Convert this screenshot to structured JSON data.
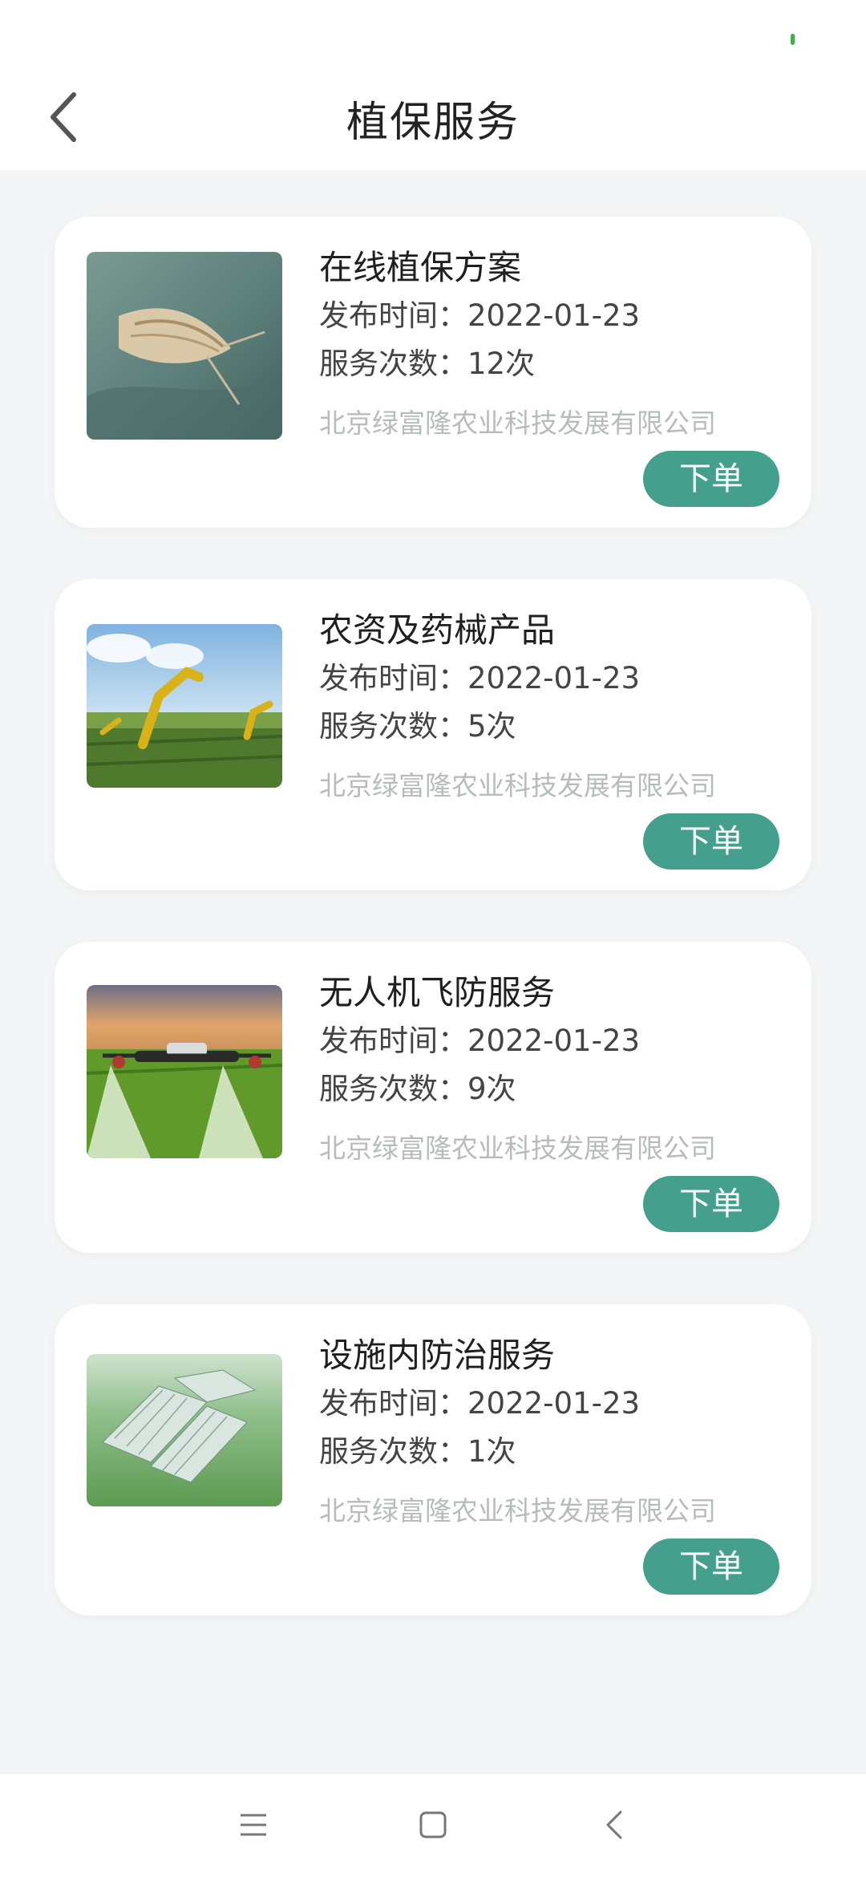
{
  "header": {
    "title": "植保服务"
  },
  "cards": [
    {
      "title": "在线植保方案",
      "publish": "发布时间：2022-01-23",
      "count": "服务次数：12次",
      "company": "北京绿富隆农业科技发展有限公司",
      "button": "下单",
      "image_icon": "moth-photo"
    },
    {
      "title": "农资及药械产品",
      "publish": "发布时间：2022-01-23",
      "count": "服务次数：5次",
      "company": "北京绿富隆农业科技发展有限公司",
      "button": "下单",
      "image_icon": "farm-robot-arms-photo"
    },
    {
      "title": "无人机飞防服务",
      "publish": "发布时间：2022-01-23",
      "count": "服务次数：9次",
      "company": "北京绿富隆农业科技发展有限公司",
      "button": "下单",
      "image_icon": "spraying-drone-photo"
    },
    {
      "title": "设施内防治服务",
      "publish": "发布时间：2022-01-23",
      "count": "服务次数：1次",
      "company": "北京绿富隆农业科技发展有限公司",
      "button": "下单",
      "image_icon": "greenhouse-aerial-photo"
    }
  ],
  "colors": {
    "accent": "#44a08c",
    "company_text": "#b8babd",
    "background": "#f4f5f7"
  }
}
